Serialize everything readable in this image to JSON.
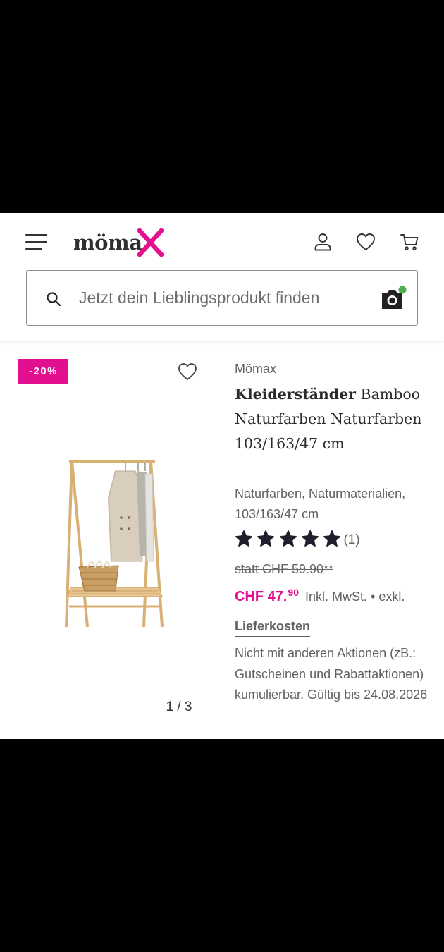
{
  "header": {
    "logo_text": "möma",
    "search_placeholder": "Jetzt dein Lieblingsprodukt finden"
  },
  "product": {
    "badge": "-20%",
    "gallery_counter": "1 / 3",
    "brand": "Mömax",
    "title_bold": "Kleiderständer",
    "title_rest": " Bamboo Naturfarben Naturfarben 103/163/47 cm",
    "subtitle": "Naturfarben, Naturmaterialien, 103/163/47 cm",
    "rating": {
      "stars": 5,
      "max": 5,
      "count": "(1)"
    },
    "old_price": "statt CHF 59.90**",
    "price_main": "CHF 47.",
    "price_cents": "90",
    "vat_text": "Inkl. MwSt.",
    "separator": "•",
    "excl_text": "exkl.",
    "shipping_link": "Lieferkosten",
    "notice": "Nicht mit anderen Aktionen (zB.: Gutscheinen und Rabattaktionen) kumulierbar. Gültig bis 24.08.2026"
  },
  "colors": {
    "brand_pink": "#e2108e",
    "camera_badge": "#4caf50",
    "text_dark": "#2b2b2b",
    "text_muted": "#616161"
  },
  "icons": [
    "menu-icon",
    "account-icon",
    "heart-icon",
    "cart-icon",
    "search-icon",
    "camera-icon",
    "star-icon"
  ]
}
